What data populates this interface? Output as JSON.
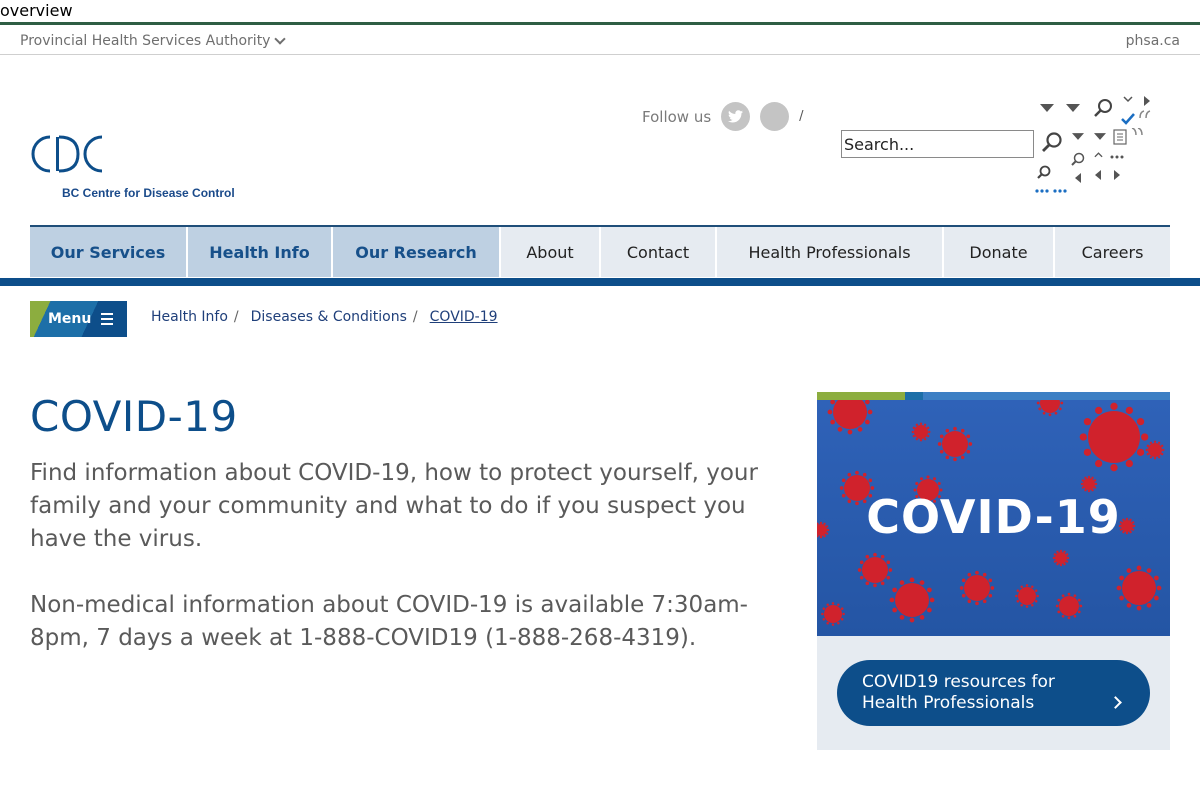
{
  "skip_link": "overview",
  "phsa_bar": {
    "authority": "Provincial Health Services Authority",
    "site": "phsa.ca"
  },
  "logo": {
    "org_name": "BC Centre for Disease Control"
  },
  "social": {
    "follow_label": "Follow us",
    "separator": "/",
    "icons": [
      "twitter-icon",
      "social-icon"
    ]
  },
  "search": {
    "placeholder": "Search..."
  },
  "nav": {
    "items": [
      {
        "label": "Our Services",
        "primary": true
      },
      {
        "label": "Health Info",
        "primary": true
      },
      {
        "label": "Our Research",
        "primary": true
      },
      {
        "label": "About",
        "primary": false
      },
      {
        "label": "Contact",
        "primary": false
      },
      {
        "label": "Health Professionals",
        "primary": false
      },
      {
        "label": "Donate",
        "primary": false
      },
      {
        "label": "Careers",
        "primary": false
      }
    ]
  },
  "menu": {
    "label": "Menu"
  },
  "breadcrumb": {
    "items": [
      "Health Info",
      "Diseases & Conditions",
      "COVID-19"
    ]
  },
  "main": {
    "title": "COVID-19",
    "lead": "Find information about COVID-19, how to protect yourself, your family and your community and what to do if you suspect you have the virus.",
    "info": "Non-medical information about COVID-19 is available 7:30am-8pm, 7 days a week at 1-888-COVID19 (1-888-268-4319)."
  },
  "promo": {
    "image_text": "COVID-19",
    "button_label": "COVID19 resources for Health Professionals"
  },
  "colors": {
    "brand_blue": "#0d4e8a",
    "nav_primary_bg": "#bed0e2",
    "nav_secondary_bg": "#e6ebf1",
    "accent_green": "#8cad3f",
    "phsa_green": "#2e5e44",
    "virus_red": "#d0222c"
  }
}
